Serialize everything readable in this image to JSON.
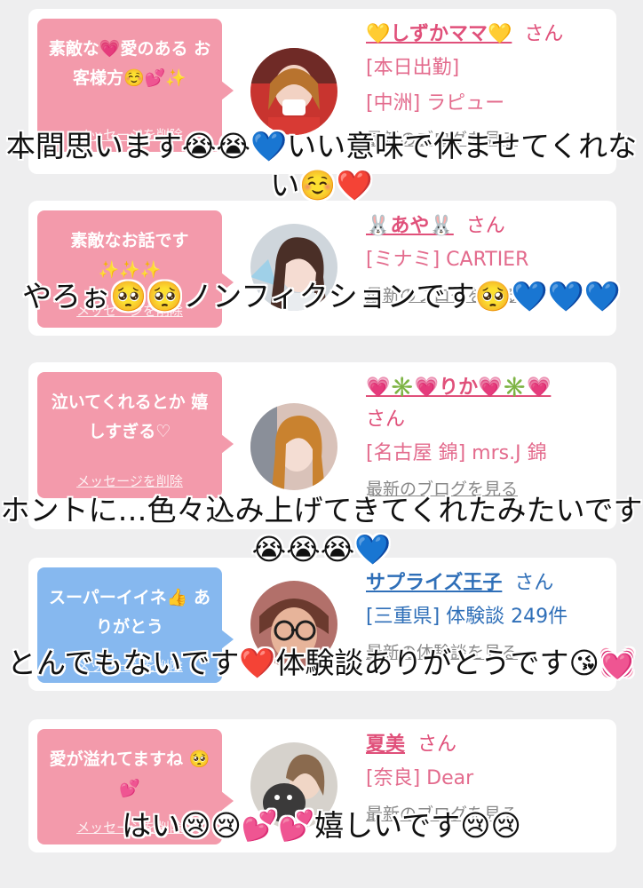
{
  "cards": [
    {
      "bubble": "素敵な💗愛のある お客様方☺️💕✨",
      "delete_label": "メッセージを削除",
      "name": "💛しずかママ💛",
      "honorific": "さん",
      "line1": "[本日出勤]",
      "line2": "[中洲] ラピュー",
      "blog_label": "最新のブログを見る"
    },
    {
      "bubble": "素敵なお話です ✨✨✨",
      "delete_label": "メッセージを削除",
      "name": "🐰あや🐰",
      "honorific": "さん",
      "line1": "[ミナミ] CARTIER",
      "blog_label": "最新のブログを見る"
    },
    {
      "bubble": "泣いてくれるとか 嬉しすぎる♡",
      "delete_label": "メッセージを削除",
      "name": "💗✳️💗りか💗✳️💗",
      "honorific": "さん",
      "line1": "[名古屋 錦] mrs.J 錦",
      "blog_label": "最新のブログを見る"
    },
    {
      "bubble": "スーパーイイネ👍 ありがとう",
      "delete_label": "メッセージを削除",
      "name": "サプライズ王子",
      "honorific": "さん",
      "line1": "[三重県] 体験談 249件",
      "blog_label": "最新の体験談を見る"
    },
    {
      "bubble": "愛が溢れてますね 🥺💕",
      "delete_label": "メッセージを削除",
      "name": "夏美",
      "honorific": "さん",
      "line1": "[奈良] Dear",
      "blog_label": "最新のブログを見る"
    }
  ],
  "captions": [
    "本間思います😭😭💙いい意味で休ませてくれない☺️❤️",
    "やろぉ🥺🥺ノンフィクションです🥺💙💙💙",
    "ホントに…色々込み上げてきてくれたみたいです😭😭😭💙",
    "とんでもないです❤️体験談ありがとうです😘💓",
    "はい😢😢💕💕嬉しいです😢😢"
  ],
  "colors": {
    "pink_bubble": "#f39aab",
    "blue_bubble": "#86b8ef",
    "name_pink": "#e0507a",
    "name_blue": "#2f6fb8"
  }
}
